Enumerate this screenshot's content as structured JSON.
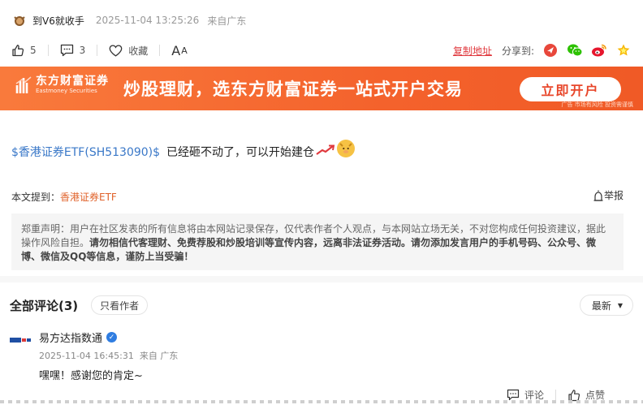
{
  "post": {
    "author": "到V6就收手",
    "time": "2025-11-04 13:25:26",
    "from": "来自广东"
  },
  "actions": {
    "likes": "5",
    "comments": "3",
    "collect_label": "收藏",
    "font_label": "A",
    "font_label_small": "A",
    "copy_link": "复制地址",
    "share_label": "分享到:"
  },
  "banner": {
    "logo_cn": "东方财富证券",
    "logo_en": "Eastmoney Securities",
    "slogan": "炒股理财，选东方财富证券一站式开户交易",
    "button": "立即开户",
    "note": "广告 市场有风险 投资需谨慎"
  },
  "body": {
    "stock_link": "$香港证券ETF(SH513090)$",
    "text": "已经砸不动了，可以开始建仓"
  },
  "mention": {
    "label": "本文提到：",
    "link": "香港证券ETF"
  },
  "report_label": "举报",
  "disclaimer": {
    "normal": "郑重声明：用户在社区发表的所有信息将由本网站记录保存，仅代表作者个人观点，与本网站立场无关，不对您构成任何投资建议，据此操作风险自担。",
    "bold": "请勿相信代客理财、免费荐股和炒股培训等宣传内容，远离非法证券活动。请勿添加发言用户的手机号码、公众号、微博、微信及QQ等信息，谨防上当受骗！"
  },
  "comments": {
    "title": "全部评论(3)",
    "only_author": "只看作者",
    "sort": "最新",
    "items": [
      {
        "name": "易方达指数通",
        "time": "2025-11-04 16:45:31",
        "from": "来自 广东",
        "text": "嘿嘿！感谢您的肯定~",
        "reply_label": "评论",
        "like_label": "点赞"
      }
    ]
  },
  "colors": {
    "accent_red": "#e0393e",
    "banner_orange": "#f4622c",
    "link_blue": "#3a78c8",
    "mention_orange": "#e0622a"
  }
}
